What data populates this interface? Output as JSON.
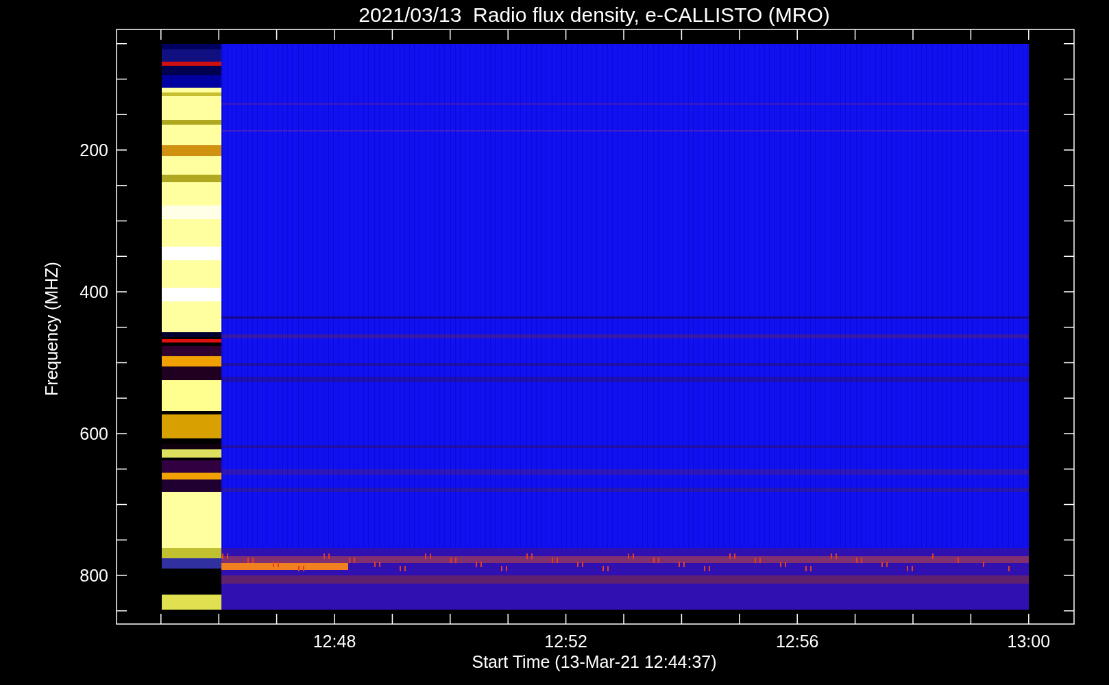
{
  "title": "2021/03/13  Radio flux density, e-CALLISTO (MRO)",
  "y_axis": {
    "label": "Frequency (MHZ)",
    "ticks": [
      "200",
      "400",
      "600",
      "800"
    ]
  },
  "x_axis": {
    "label": "Start Time (13-Mar-21 12:44:37)",
    "ticks": [
      "12:48",
      "12:52",
      "12:56",
      "13:00"
    ]
  }
}
